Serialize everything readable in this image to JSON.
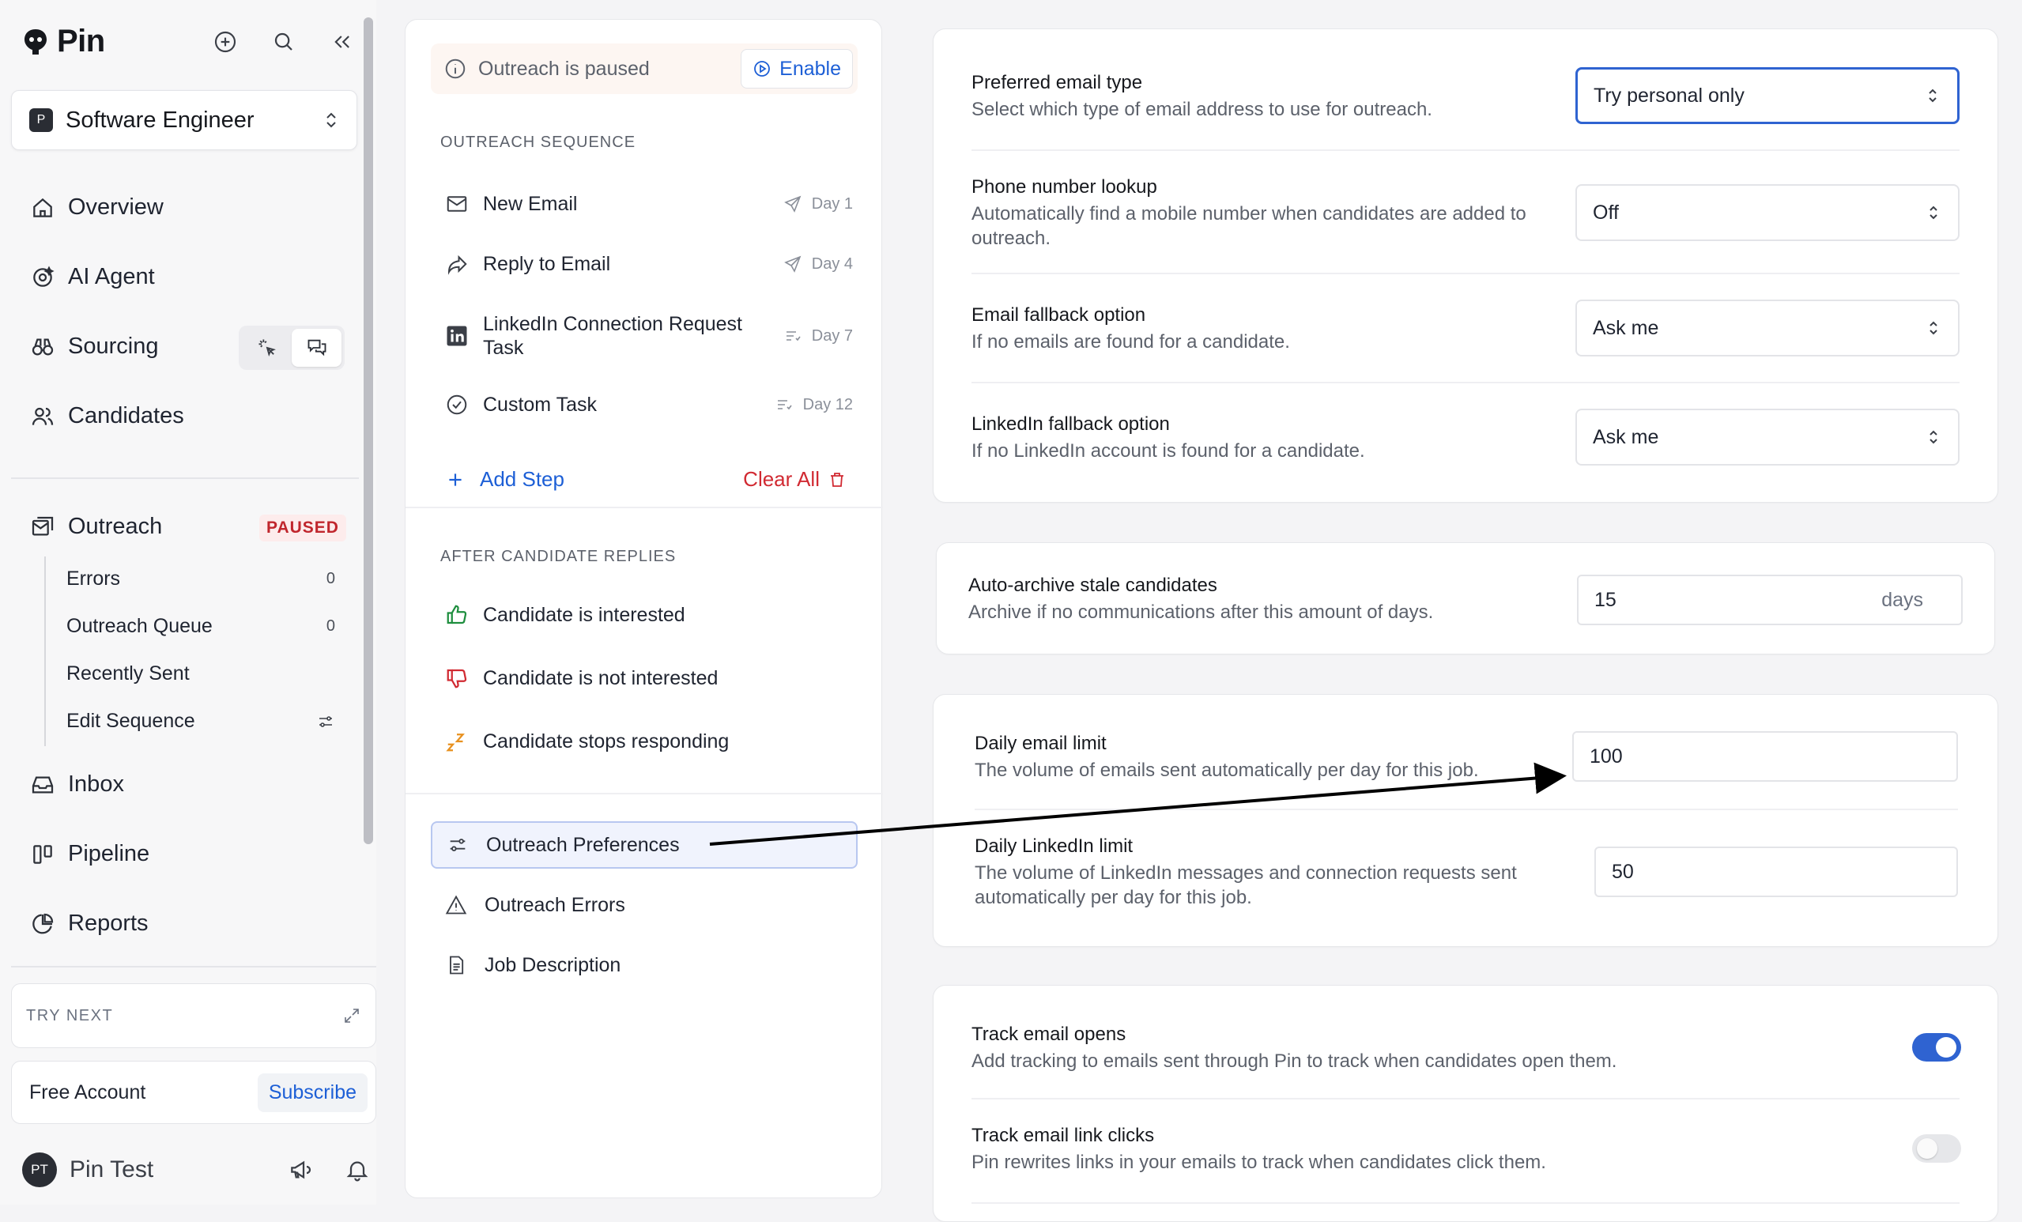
{
  "app": {
    "name": "Pin"
  },
  "job": {
    "badge": "P",
    "name": "Software Engineer"
  },
  "nav": {
    "overview": "Overview",
    "ai_agent": "AI Agent",
    "sourcing": "Sourcing",
    "candidates": "Candidates",
    "outreach": "Outreach",
    "outreach_badge": "PAUSED",
    "inbox": "Inbox",
    "pipeline": "Pipeline",
    "reports": "Reports"
  },
  "outreach_sub": [
    {
      "label": "Errors",
      "count": "0"
    },
    {
      "label": "Outreach Queue",
      "count": "0"
    },
    {
      "label": "Recently Sent",
      "count": ""
    },
    {
      "label": "Edit Sequence",
      "count": ""
    }
  ],
  "try_next": {
    "label": "TRY NEXT"
  },
  "account": {
    "label": "Free Account",
    "subscribe": "Subscribe"
  },
  "user": {
    "initials": "PT",
    "name": "Pin Test"
  },
  "middle": {
    "paused_text": "Outreach is paused",
    "enable_label": "Enable",
    "sequence_header": "OUTREACH SEQUENCE",
    "steps": [
      {
        "label": "New Email",
        "day": "Day 1",
        "icon": "mail-icon"
      },
      {
        "label": "Reply to Email",
        "day": "Day 4",
        "icon": "reply-icon"
      },
      {
        "label": "LinkedIn Connection Request Task",
        "day": "Day 7",
        "icon": "linkedin-icon"
      },
      {
        "label": "Custom Task",
        "day": "Day 12",
        "icon": "check-circle-icon"
      }
    ],
    "add_step": "Add Step",
    "clear_all": "Clear All",
    "after_header": "AFTER CANDIDATE REPLIES",
    "replies": [
      {
        "label": "Candidate is interested",
        "icon": "thumbs-up-icon"
      },
      {
        "label": "Candidate is not interested",
        "icon": "thumbs-down-icon"
      },
      {
        "label": "Candidate stops responding",
        "icon": "sleep-icon"
      }
    ],
    "prefs": [
      {
        "label": "Outreach Preferences",
        "icon": "sliders-icon"
      },
      {
        "label": "Outreach Errors",
        "icon": "warning-icon"
      },
      {
        "label": "Job Description",
        "icon": "document-icon"
      }
    ]
  },
  "settings": {
    "preferred_email": {
      "title": "Preferred email type",
      "desc": "Select which type of email address to use for outreach.",
      "value": "Try personal only"
    },
    "phone_lookup": {
      "title": "Phone number lookup",
      "desc": "Automatically find a mobile number when candidates are added to outreach.",
      "value": "Off"
    },
    "email_fallback": {
      "title": "Email fallback option",
      "desc": "If no emails are found for a candidate.",
      "value": "Ask me"
    },
    "linkedin_fallback": {
      "title": "LinkedIn fallback option",
      "desc": "If no LinkedIn account is found for a candidate.",
      "value": "Ask me"
    },
    "auto_archive": {
      "title": "Auto-archive stale candidates",
      "desc": "Archive if no communications after this amount of days.",
      "value": "15",
      "unit": "days"
    },
    "daily_email": {
      "title": "Daily email limit",
      "desc": "The volume of emails sent automatically per day for this job.",
      "value": "100"
    },
    "daily_linkedin": {
      "title": "Daily LinkedIn limit",
      "desc": "The volume of LinkedIn messages and connection requests sent automatically per day for this job.",
      "value": "50"
    },
    "track_opens": {
      "title": "Track email opens",
      "desc": "Add tracking to emails sent through Pin to track when candidates open them.",
      "enabled": true
    },
    "track_clicks": {
      "title": "Track email link clicks",
      "desc": "Pin rewrites links in your emails to track when candidates click them.",
      "enabled": false
    }
  },
  "colors": {
    "accent": "#2f63d1",
    "danger": "#d12a32",
    "link": "#1d5fd6"
  }
}
